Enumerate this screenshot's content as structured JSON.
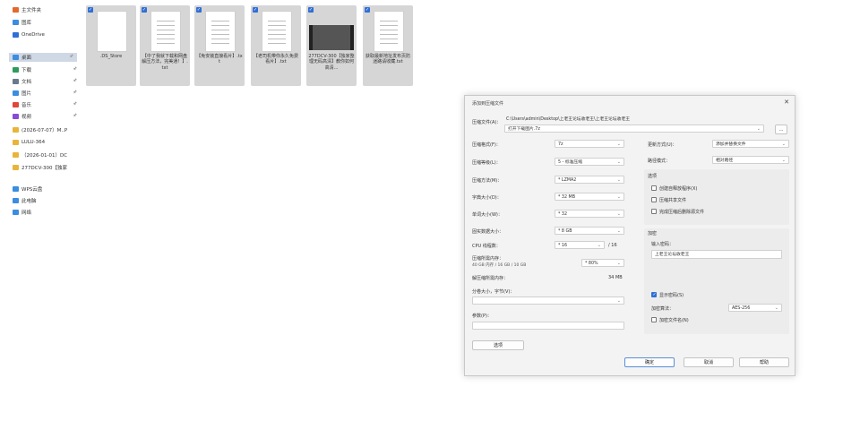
{
  "sidebar": {
    "items": [
      {
        "label": "主文件夹",
        "icon": "home-icon",
        "color": "#e26a2c"
      },
      {
        "label": "图库",
        "icon": "gallery-icon",
        "color": "#3a8de0"
      },
      {
        "label": "OneDrive",
        "icon": "onedrive-cloud-icon",
        "color": "#2f6fd6"
      },
      {
        "label": "桌面",
        "icon": "desktop-icon",
        "color": "#3a8de0",
        "pin": "🖈"
      },
      {
        "label": "下载",
        "icon": "download-icon",
        "color": "#2e9b5d",
        "pin": "🖈"
      },
      {
        "label": "文档",
        "icon": "document-icon",
        "color": "#6a7a8c",
        "pin": "🖈"
      },
      {
        "label": "图片",
        "icon": "pictures-icon",
        "color": "#3a8de0",
        "pin": "🖈"
      },
      {
        "label": "音乐",
        "icon": "music-icon",
        "color": "#e0463a",
        "pin": "🖈"
      },
      {
        "label": "视频",
        "icon": "video-icon",
        "color": "#8a4ad6",
        "pin": "🖈"
      },
      {
        "label": "(2026-07-07）M..P",
        "icon": "folder-icon",
        "color": "#e8b53a"
      },
      {
        "label": "LULU-364",
        "icon": "folder-icon",
        "color": "#e8b53a"
      },
      {
        "label": "（2026-01-01）DC",
        "icon": "folder-icon",
        "color": "#e8b53a"
      },
      {
        "label": "277DCV-300【独家",
        "icon": "folder-icon",
        "color": "#e8b53a"
      },
      {
        "label": "WPS云盘",
        "icon": "wps-cloud-icon",
        "color": "#3a8de0"
      },
      {
        "label": "此电脑",
        "icon": "this-pc-icon",
        "color": "#3a8de0"
      },
      {
        "label": "网络",
        "icon": "network-icon",
        "color": "#3a8de0"
      }
    ]
  },
  "files": [
    {
      "name": ".DS_Store",
      "kind": "file",
      "icon": "blank-file-icon"
    },
    {
      "name": "【中了我就下载和网盘解压方法，完美通！】.txt",
      "kind": "txt",
      "icon": "text-file-icon"
    },
    {
      "name": "【免安装直接看片】.txt",
      "kind": "txt",
      "icon": "text-file-icon"
    },
    {
      "name": "【老司机带你永久免费看片】.txt",
      "kind": "txt",
      "icon": "text-file-icon"
    },
    {
      "name": "277DCV-300【独家整理无码高清】教你如何高清...",
      "kind": "video",
      "icon": "video-thumbnail-icon"
    },
    {
      "name": "获取最新地址发布页防迷路请收藏.txt",
      "kind": "txt",
      "icon": "text-file-icon"
    }
  ],
  "dialog": {
    "title": "添加到压缩文件",
    "close": "✕",
    "archive_label": "压缩文件(A)：",
    "archive_path": "C:\\Users\\admin\\Desktop\\上老王论坛收老王\\上老王论坛收老王",
    "archive_name": "打开下载图片.7z",
    "browse": "...",
    "format_label": "压缩格式(F)：",
    "format_value": "7z",
    "level_label": "压缩等级(L)：",
    "level_value": "5 - 标准压缩",
    "method_label": "压缩方法(M)：",
    "method_value": "* LZMA2",
    "dict_label": "字典大小(D)：",
    "dict_value": "* 32 MB",
    "word_label": "单词大小(W)：",
    "word_value": "* 32",
    "solid_label": "固实数据大小：",
    "solid_value": "* 8 GB",
    "threads_label": "CPU 线程数：",
    "threads_value": "* 16",
    "threads_total": "/ 16",
    "mem_label": "压缩所需内存：",
    "mem_sub": "40 GB 内存 / 16 GB / 10 GB",
    "mem_value": "* 80%",
    "decomp_label": "解压缩所需内存：",
    "decomp_value": "34 MB",
    "split_label": "分卷大小，字节(V)：",
    "split_value": "",
    "params_label": "参数(P)：",
    "params_value": "",
    "options_btn": "选项",
    "update_label": "更新方式(U)：",
    "update_value": "添加并替换文件",
    "path_label": "路径模式：",
    "path_value": "相对路径",
    "opts_title": "选项",
    "opt1": "创建自释放程序(X)",
    "opt2": "压缩共享文件",
    "opt3": "完成压缩后删除源文件",
    "enc_title": "加密",
    "pwd_label": "输入密码：",
    "pwd_value": "上老王论坛收老王",
    "show_pwd": "显示密码(S)",
    "enc_method_label": "加密算法：",
    "enc_method_value": "AES-256",
    "enc_names": "加密文件名(N)",
    "ok": "确定",
    "cancel": "取消",
    "help": "帮助"
  },
  "colors": {
    "accent": "#2f6fd6",
    "selection": "#d6d6d6",
    "nav_selected": "#cfd9e6"
  }
}
